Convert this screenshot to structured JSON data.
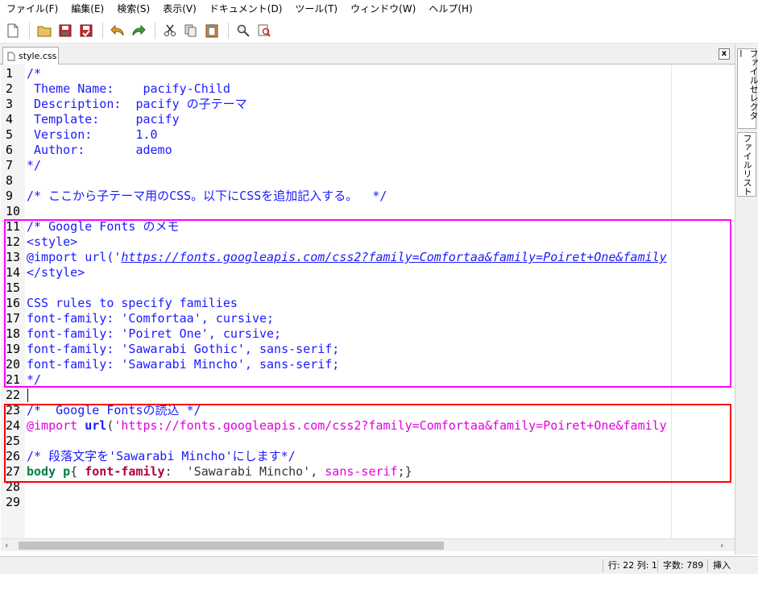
{
  "menu": [
    "ファイル(F)",
    "編集(E)",
    "検索(S)",
    "表示(V)",
    "ドキュメント(D)",
    "ツール(T)",
    "ウィンドウ(W)",
    "ヘルプ(H)"
  ],
  "toolbar": {
    "icons": [
      "new-file-icon",
      "open-folder-icon",
      "save-icon",
      "save-all-icon",
      "undo-icon",
      "redo-icon",
      "cut-icon",
      "copy-icon",
      "paste-icon",
      "find-icon",
      "replace-icon"
    ]
  },
  "tab": {
    "label": "style.css",
    "close": "x"
  },
  "side_tabs": [
    "ファイルセレクター",
    "ファイルリスト"
  ],
  "lines": [
    {
      "n": "1",
      "segs": [
        [
          "/*",
          "blue"
        ]
      ]
    },
    {
      "n": "2",
      "segs": [
        [
          " Theme Name:    pacify-Child",
          "blue"
        ]
      ]
    },
    {
      "n": "3",
      "segs": [
        [
          " Description:  pacify の子テーマ",
          "blue"
        ]
      ]
    },
    {
      "n": "4",
      "segs": [
        [
          " Template:     pacify",
          "blue"
        ]
      ]
    },
    {
      "n": "5",
      "segs": [
        [
          " Version:      1.0",
          "blue"
        ]
      ]
    },
    {
      "n": "6",
      "segs": [
        [
          " Author:       ademo",
          "blue"
        ]
      ]
    },
    {
      "n": "7",
      "segs": [
        [
          "*/",
          "blue"
        ]
      ]
    },
    {
      "n": "8",
      "segs": []
    },
    {
      "n": "9",
      "segs": [
        [
          "/* ここから子テーマ用のCSS。以下にCSSを追加記入する。  */",
          "blue"
        ]
      ]
    },
    {
      "n": "10",
      "segs": []
    },
    {
      "n": "11",
      "segs": [
        [
          "/* Google Fonts のメモ",
          "blue"
        ]
      ]
    },
    {
      "n": "12",
      "segs": [
        [
          "<style>",
          "blue"
        ]
      ]
    },
    {
      "n": "13",
      "segs": [
        [
          "@import url('",
          "blue"
        ],
        [
          "https://fonts.googleapis.com/css2?family=Comfortaa&family=Poiret+One&family",
          "url-it"
        ]
      ]
    },
    {
      "n": "14",
      "segs": [
        [
          "</style>",
          "blue"
        ]
      ]
    },
    {
      "n": "15",
      "segs": []
    },
    {
      "n": "16",
      "segs": [
        [
          "CSS rules to specify families",
          "blue"
        ]
      ]
    },
    {
      "n": "17",
      "segs": [
        [
          "font-family: 'Comfortaa', cursive;",
          "blue"
        ]
      ]
    },
    {
      "n": "18",
      "segs": [
        [
          "font-family: 'Poiret One', cursive;",
          "blue"
        ]
      ]
    },
    {
      "n": "19",
      "segs": [
        [
          "font-family: 'Sawarabi Gothic', sans-serif;",
          "blue"
        ]
      ]
    },
    {
      "n": "20",
      "segs": [
        [
          "font-family: 'Sawarabi Mincho', sans-serif;",
          "blue"
        ]
      ]
    },
    {
      "n": "21",
      "segs": [
        [
          "*/",
          "blue"
        ]
      ]
    },
    {
      "n": "22",
      "segs": []
    },
    {
      "n": "23",
      "segs": [
        [
          "/*  Google Fontsの読込 */",
          "blue"
        ]
      ]
    },
    {
      "n": "24",
      "segs": [
        [
          "@import",
          "mag"
        ],
        [
          " ",
          "dk"
        ],
        [
          "url",
          "kw-url"
        ],
        [
          "(",
          "dk"
        ],
        [
          "'https://fonts.googleapis.com/css2?family=Comfortaa&family=Poiret+One&family",
          "mag"
        ]
      ]
    },
    {
      "n": "25",
      "segs": []
    },
    {
      "n": "26",
      "segs": [
        [
          "/* 段落文字を'Sawarabi Mincho'にします*/",
          "blue"
        ]
      ]
    },
    {
      "n": "27",
      "segs": [
        [
          "body p",
          "grn"
        ],
        [
          "{ ",
          "dk"
        ],
        [
          "font-family",
          "dred"
        ],
        [
          ":  'Sawarabi Mincho', ",
          "dk"
        ],
        [
          "sans-serif",
          "mag"
        ],
        [
          ";}",
          "dk"
        ]
      ]
    },
    {
      "n": "28",
      "segs": []
    },
    {
      "n": "29",
      "segs": []
    }
  ],
  "status": {
    "position": "行: 22 列: 1",
    "chars": "字数: 789",
    "mode": "挿入"
  },
  "colors": {
    "highlight_box_1": "#ff00ff",
    "highlight_box_2": "#ff0000",
    "comment": "#1a1aff"
  }
}
